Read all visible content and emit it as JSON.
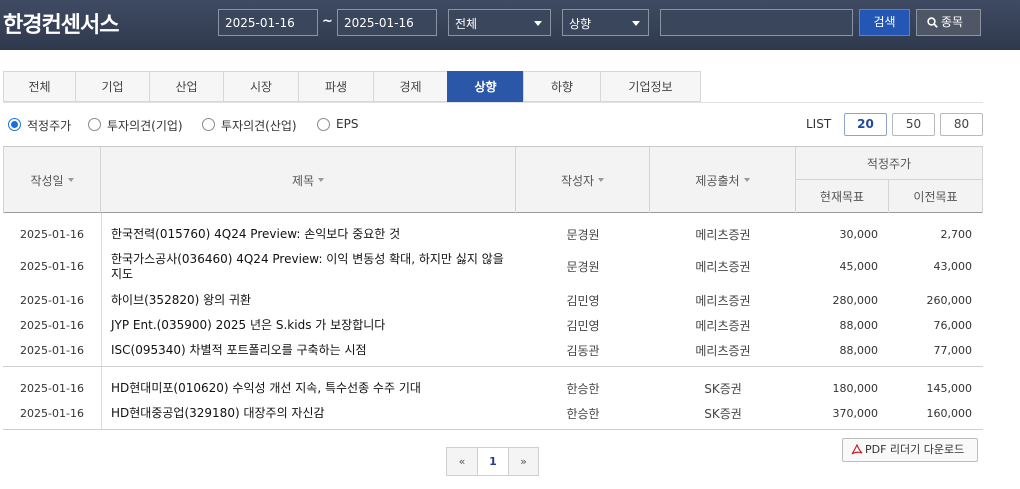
{
  "header": {
    "logo": "한경컨센서스",
    "date_from": "2025-01-16",
    "date_to": "2025-01-16",
    "range_sep": "~",
    "category_select": "전체",
    "direction_select": "상향",
    "search_value": "",
    "search_button": "검색",
    "stock_button": "종목"
  },
  "tabs": [
    {
      "label": "전체"
    },
    {
      "label": "기업"
    },
    {
      "label": "산업"
    },
    {
      "label": "시장"
    },
    {
      "label": "파생"
    },
    {
      "label": "경제"
    },
    {
      "label": "상향",
      "active": true
    },
    {
      "label": "하향"
    },
    {
      "label": "기업정보"
    }
  ],
  "filters": {
    "options": [
      {
        "label": "적정주가",
        "selected": true
      },
      {
        "label": "투자의견(기업)",
        "selected": false
      },
      {
        "label": "투자의견(산업)",
        "selected": false
      },
      {
        "label": "EPS",
        "selected": false
      }
    ]
  },
  "list": {
    "label": "LIST",
    "options": [
      "20",
      "50",
      "80"
    ],
    "selected": "20"
  },
  "table": {
    "headers": {
      "date": "작성일",
      "title": "제목",
      "author": "작성자",
      "source": "제공출처",
      "target_group": "적정주가",
      "current": "현재목표",
      "previous": "이전목표"
    },
    "rows": [
      {
        "date": "2025-01-16",
        "title": "한국전력(015760) 4Q24 Preview: 손익보다 중요한 것",
        "author": "문경원",
        "source": "메리츠증권",
        "current": "30,000",
        "previous": "2,700"
      },
      {
        "date": "2025-01-16",
        "title": "한국가스공사(036460) 4Q24 Preview: 이익 변동성 확대, 하지만 싫지 않을지도",
        "author": "문경원",
        "source": "메리츠증권",
        "current": "45,000",
        "previous": "43,000"
      },
      {
        "date": "2025-01-16",
        "title": "하이브(352820) 왕의 귀환",
        "author": "김민영",
        "source": "메리츠증권",
        "current": "280,000",
        "previous": "260,000"
      },
      {
        "date": "2025-01-16",
        "title": "JYP Ent.(035900) 2025 년은 S.kids 가 보장합니다",
        "author": "김민영",
        "source": "메리츠증권",
        "current": "88,000",
        "previous": "76,000"
      },
      {
        "date": "2025-01-16",
        "title": "ISC(095340) 차별적 포트폴리오를 구축하는 시점",
        "author": "김동관",
        "source": "메리츠증권",
        "current": "88,000",
        "previous": "77,000"
      },
      {
        "date": "2025-01-16",
        "title": "HD현대미포(010620) 수익성 개선 지속, 특수선종 수주 기대",
        "author": "한승한",
        "source": "SK증권",
        "current": "180,000",
        "previous": "145,000"
      },
      {
        "date": "2025-01-16",
        "title": "HD현대중공업(329180) 대장주의 자신감",
        "author": "한승한",
        "source": "SK증권",
        "current": "370,000",
        "previous": "160,000"
      }
    ]
  },
  "pdf_button": "PDF 리더기 다운로드",
  "pagination": {
    "prev": "«",
    "current": "1",
    "next": "»"
  },
  "icons": {
    "search": "search-icon",
    "pdf": "pdf-icon",
    "caret": "chevron-down-icon"
  },
  "colors": {
    "header_bg": "#36415a",
    "accent": "#2a57a8",
    "search_button": "#2456b5"
  }
}
